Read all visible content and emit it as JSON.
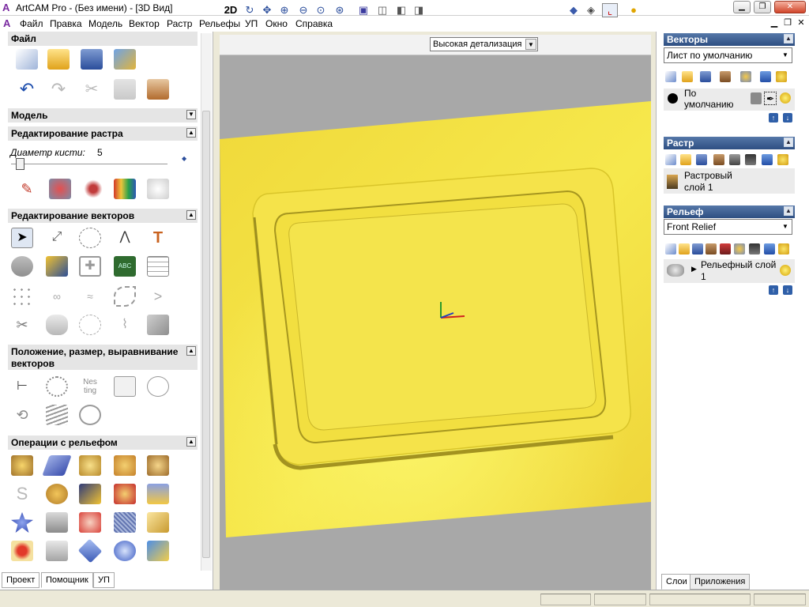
{
  "title_bar": {
    "app_title": "ArtCAM Pro - (Без имени) - [3D Вид]"
  },
  "menu": [
    "Файл",
    "Правка",
    "Модель",
    "Вектор",
    "Растр",
    "Рельефы",
    "УП",
    "Окно",
    "Справка"
  ],
  "left_panel": {
    "section_file": "Файл",
    "section_model": "Модель",
    "section_raster_edit": "Редактирование растра",
    "brush_label": "Диаметр кисти:",
    "brush_value": "5",
    "section_vector_edit": "Редактирование векторов",
    "section_position": "Положение, размер, выравнивание векторов",
    "nesting_text": "Nes ting",
    "section_relief_ops": "Операции с рельефом",
    "tabs": [
      "Проект",
      "Помощник",
      "УП"
    ]
  },
  "toolbar": {
    "mode_2d": "2D",
    "detail_select": "Высокая детализация"
  },
  "right_panel": {
    "vectors": {
      "title": "Векторы",
      "sheet_select": "Лист по умолчанию",
      "layer_name": "По умолчанию"
    },
    "raster": {
      "title": "Растр",
      "layer_name": "Растровый слой 1"
    },
    "relief": {
      "title": "Рельеф",
      "relief_select": "Front Relief",
      "layer_name": "Рельефный слой 1"
    },
    "tabs": [
      "Слои",
      "Приложения"
    ]
  },
  "colors": {
    "relief_yellow": "#f2df3a",
    "panel_header_blue": "#3b5f92",
    "view_background": "#a8a8a8"
  }
}
